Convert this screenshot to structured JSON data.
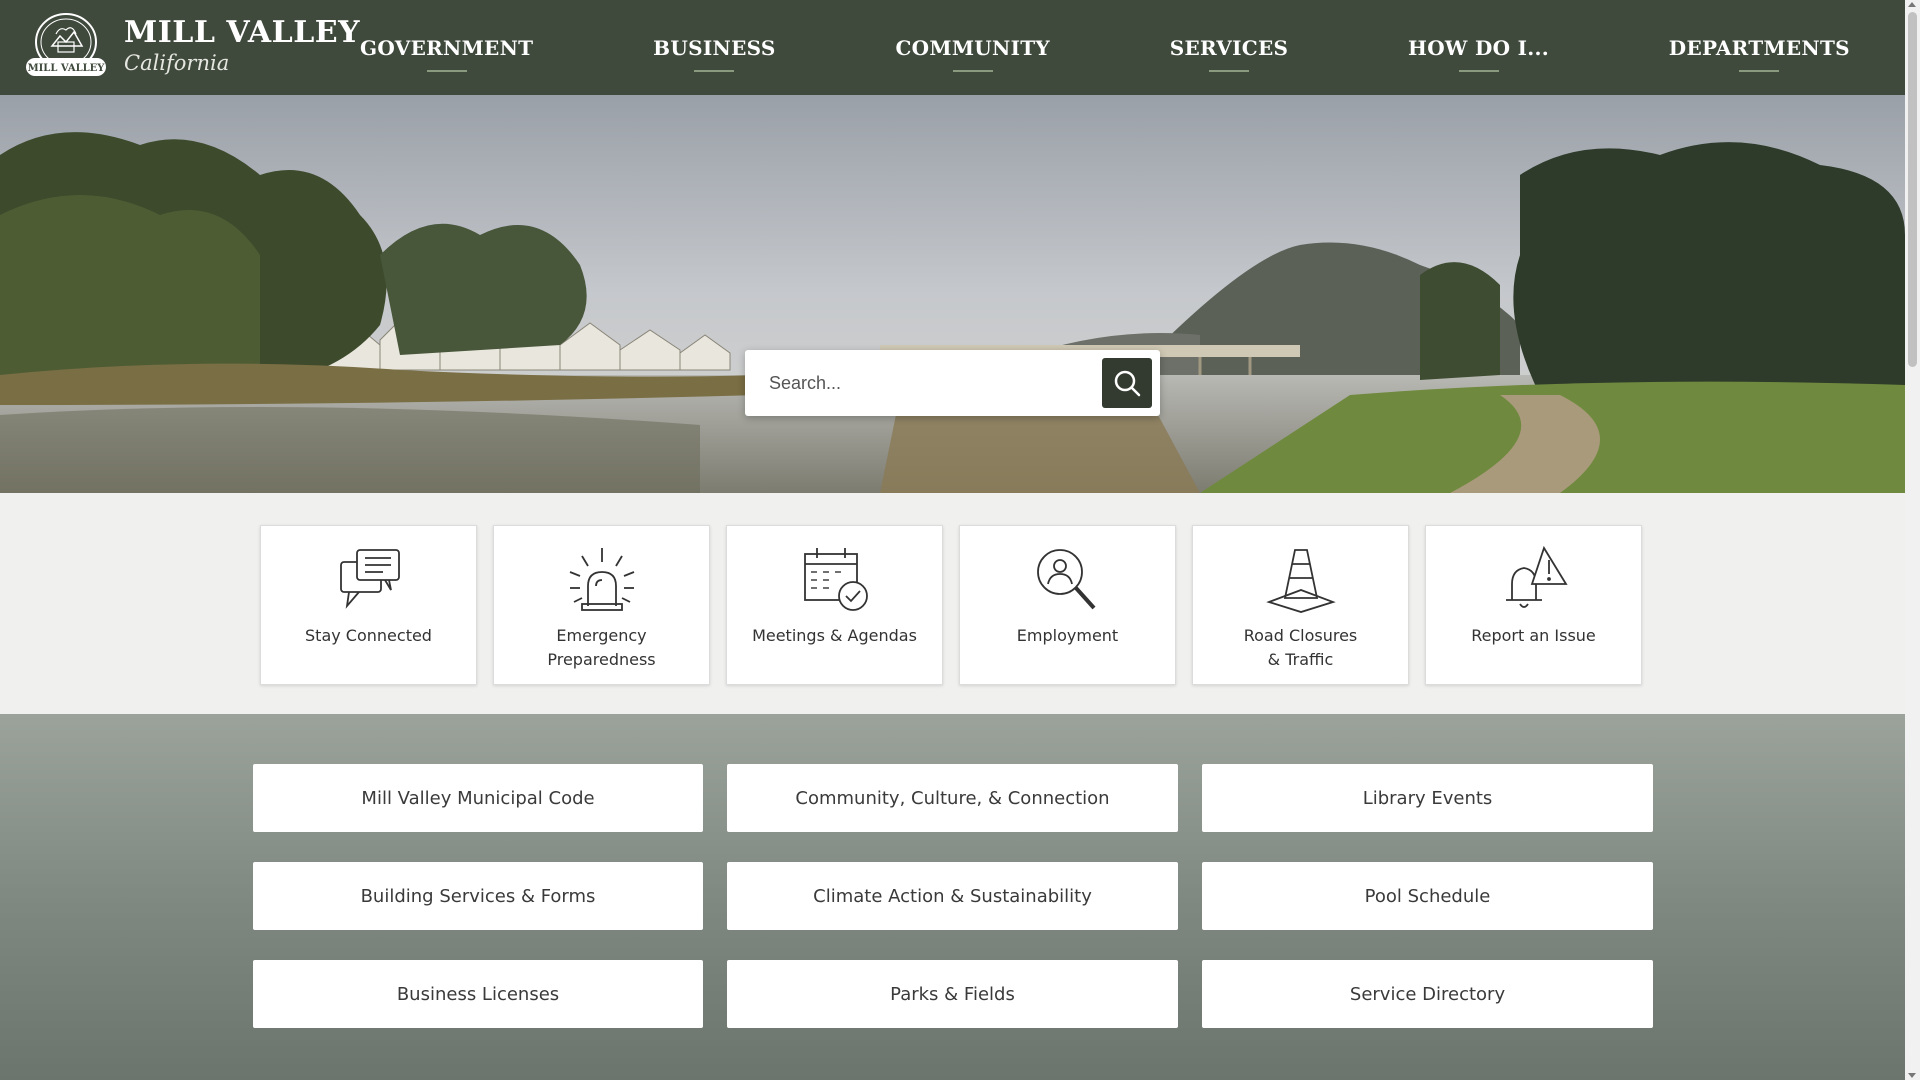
{
  "site": {
    "title": "MILL VALLEY",
    "subtitle": "California",
    "seal_text": "MILL VALLEY"
  },
  "nav": {
    "items": [
      {
        "label": "GOVERNMENT"
      },
      {
        "label": "BUSINESS"
      },
      {
        "label": "COMMUNITY"
      },
      {
        "label": "SERVICES"
      },
      {
        "label": "HOW DO I..."
      },
      {
        "label": "DEPARTMENTS"
      }
    ]
  },
  "search": {
    "placeholder": "Search...",
    "icon": "search-icon"
  },
  "quick_links": [
    {
      "label": "Stay Connected",
      "icon": "chat-bubbles-icon"
    },
    {
      "label": "Emergency\nPreparedness",
      "icon": "alarm-siren-icon"
    },
    {
      "label": "Meetings & Agendas",
      "icon": "calendar-check-icon"
    },
    {
      "label": "Employment",
      "icon": "person-search-icon"
    },
    {
      "label": "Road Closures\n& Traffic",
      "icon": "traffic-cone-icon"
    },
    {
      "label": "Report an Issue",
      "icon": "bell-alert-icon"
    }
  ],
  "buttons": [
    {
      "label": "Mill Valley Municipal Code"
    },
    {
      "label": "Community, Culture, & Connection"
    },
    {
      "label": "Library Events"
    },
    {
      "label": "Building Services & Forms"
    },
    {
      "label": "Climate Action & Sustainability"
    },
    {
      "label": "Pool Schedule"
    },
    {
      "label": "Business Licenses"
    },
    {
      "label": "Parks & Fields"
    },
    {
      "label": "Service Directory"
    }
  ],
  "colors": {
    "header_bg": "#3f4a3c",
    "search_button": "#333b30",
    "quick_bg": "#f0f0ee"
  }
}
